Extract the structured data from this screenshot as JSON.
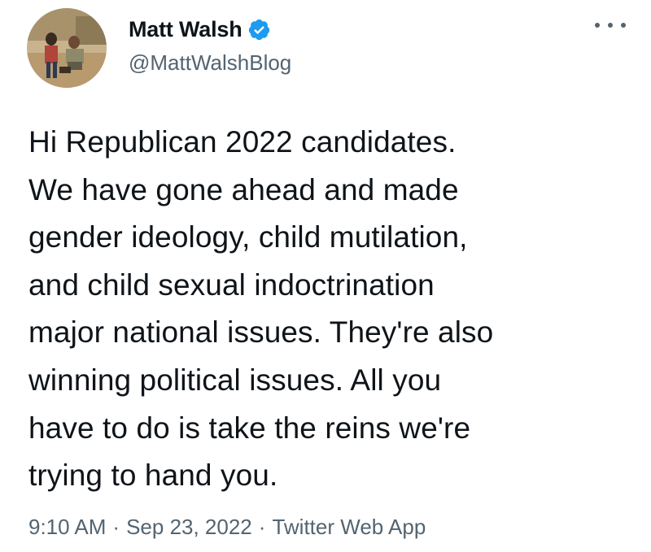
{
  "author": {
    "display_name": "Matt Walsh",
    "handle": "@MattWalshBlog",
    "verified": true,
    "avatar_icon": "profile-photo-icon",
    "verified_icon": "verified-badge-icon"
  },
  "menu": {
    "icon": "more-options-icon"
  },
  "tweet": {
    "lines": [
      "Hi Republican 2022 candidates.",
      "We have gone ahead and made",
      "gender ideology, child mutilation,",
      "and child sexual indoctrination",
      "major national issues. They're also",
      "winning political issues. All you",
      "have to do is take the reins we're",
      "trying to hand you."
    ]
  },
  "meta": {
    "time": "9:10 AM",
    "separator": "·",
    "date": "Sep 23, 2022",
    "source": "Twitter Web App"
  },
  "colors": {
    "text_primary": "#0f1419",
    "text_secondary": "#536471",
    "verified_blue": "#1d9bf0"
  }
}
